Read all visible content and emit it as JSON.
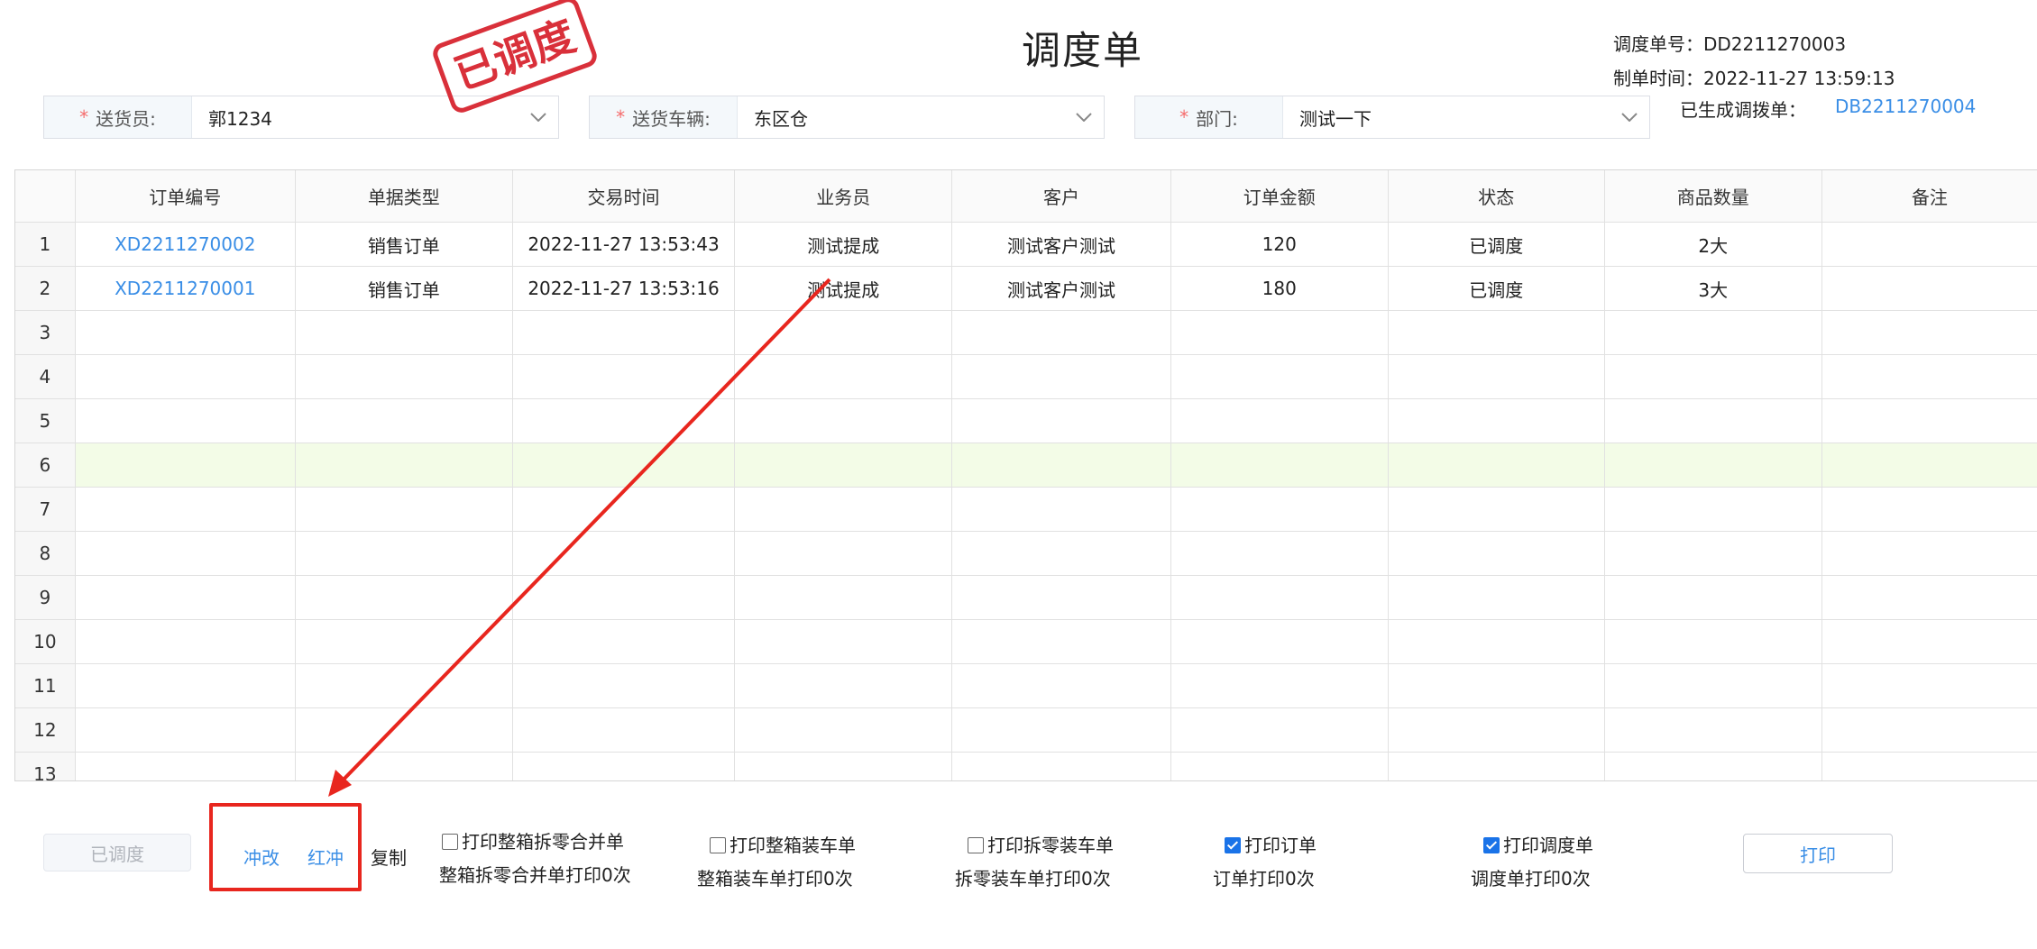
{
  "header": {
    "title": "调度单",
    "dispatch_no_label": "调度单号：",
    "dispatch_no": "DD2211270003",
    "created_label": "制单时间：",
    "created": "2022-11-27 13:59:13",
    "transfer_label": "已生成调拨单：",
    "transfer_no": "DB2211270004",
    "stamp_text": "已调度"
  },
  "fields": {
    "courier": {
      "label": "送货员:",
      "value": "郭1234"
    },
    "vehicle": {
      "label": "送货车辆:",
      "value": "东区仓"
    },
    "dept": {
      "label": "部门:",
      "value": "测试一下"
    }
  },
  "table": {
    "columns": [
      "订单编号",
      "单据类型",
      "交易时间",
      "业务员",
      "客户",
      "订单金额",
      "状态",
      "商品数量",
      "备注"
    ],
    "rows": [
      {
        "n": "1",
        "order_no": "XD2211270002",
        "type": "销售订单",
        "time": "2022-11-27 13:53:43",
        "sales": "测试提成",
        "customer": "测试客户测试",
        "amount": "120",
        "status": "已调度",
        "qty": "2大",
        "note": ""
      },
      {
        "n": "2",
        "order_no": "XD2211270001",
        "type": "销售订单",
        "time": "2022-11-27 13:53:16",
        "sales": "测试提成",
        "customer": "测试客户测试",
        "amount": "180",
        "status": "已调度",
        "qty": "3大",
        "note": ""
      }
    ],
    "empty_rows": [
      "3",
      "4",
      "5",
      "6",
      "7",
      "8",
      "9",
      "10",
      "11",
      "12",
      "13"
    ]
  },
  "footer": {
    "scheduled_button": "已调度",
    "revise": "冲改",
    "red_reverse": "红冲",
    "copy": "复制",
    "opt1_label": "打印整箱拆零合并单",
    "opt1_count": "整箱拆零合并单打印0次",
    "opt2_label": "打印整箱装车单",
    "opt2_count": "整箱装车单打印0次",
    "opt3_label": "打印拆零装车单",
    "opt3_count": "拆零装车单打印0次",
    "opt4_label": "打印订单",
    "opt4_count": "订单打印0次",
    "opt5_label": "打印调度单",
    "opt5_count": "调度单打印0次",
    "print_button": "打印",
    "checked": {
      "opt1": false,
      "opt2": false,
      "opt3": false,
      "opt4": true,
      "opt5": true
    }
  },
  "colors": {
    "accent": "#3a8ee6",
    "annotation_red": "#e8261e",
    "highlight_row": "#f3fce7",
    "stamp": "#d9303a"
  }
}
